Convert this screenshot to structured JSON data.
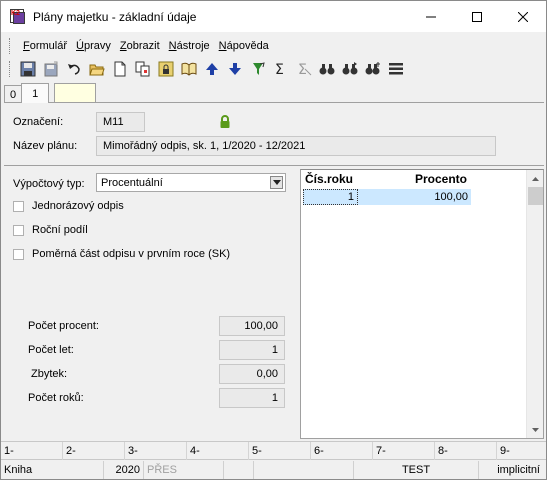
{
  "window": {
    "title": "Plány majetku - základní údaje",
    "icon_text": "K2"
  },
  "menu": [
    "Formulář",
    "Úpravy",
    "Zobrazit",
    "Nástroje",
    "Nápověda"
  ],
  "menu_underlines": [
    "F",
    "Ú",
    "Z",
    "N",
    "N"
  ],
  "toolbar": [
    "save-icon",
    "save-all-icon",
    "undo-icon",
    "open-folder-icon",
    "new-document-icon",
    "copy-icon",
    "lock-icon",
    "book-icon",
    "arrow-up-icon",
    "arrow-down-icon",
    "filter-icon",
    "sum-icon",
    "sum-disabled-icon",
    "binoculars-icon",
    "binoculars-next-icon",
    "binoculars-replace-icon",
    "list-icon"
  ],
  "tabs": {
    "tab0": "0",
    "tab1": "1"
  },
  "header": {
    "oznaceni_label": "Označení:",
    "oznaceni_value": "M11",
    "nazev_label": "Název plánu:",
    "nazev_value": "Mimořádný odpis, sk. 1, 1/2020 - 12/2021"
  },
  "form": {
    "vypoctovy_typ_label": "Výpočtový typ:",
    "vypoctovy_typ_value": "Procentuální",
    "jednorazovy": "Jednorázový odpis",
    "rocni": "Roční podíl",
    "pomerna": "Poměrná část odpisu v prvním roce (SK)",
    "pocet_procent_label": "Počet procent:",
    "pocet_procent_value": "100,00",
    "pocet_let_label": "Počet let:",
    "pocet_let_value": "1",
    "zbytek_label": "Zbytek:",
    "zbytek_value": "0,00",
    "pocet_roku_label": "Počet roků:",
    "pocet_roku_value": "1"
  },
  "grid": {
    "col1": "Čís.roku",
    "col2": "Procento",
    "rows": [
      {
        "rok": "1",
        "procento": "100,00"
      }
    ]
  },
  "fkeys": [
    "1-",
    "2-",
    "3-",
    "4-",
    "5-",
    "6-",
    "7-",
    "8-",
    "9-"
  ],
  "status": {
    "module": "Kniha",
    "year": "2020",
    "pres": "PŘES",
    "db": "TEST",
    "mode": "implicitní"
  },
  "colors": {
    "grid_selection": "#cce8ff",
    "lock_green": "#5a9a1a",
    "arrow_blue": "#1e3fa6"
  }
}
